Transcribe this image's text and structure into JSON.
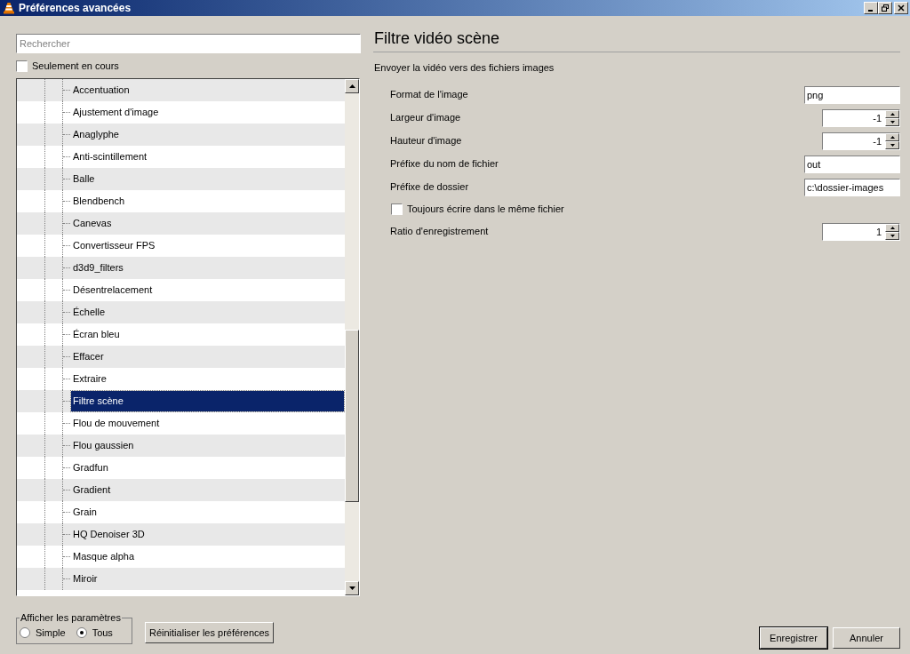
{
  "window": {
    "title": "Préférences avancées"
  },
  "search": {
    "placeholder": "Rechercher"
  },
  "only_current": {
    "label": "Seulement en cours",
    "checked": false
  },
  "tree": {
    "items": [
      {
        "label": "Accentuation",
        "selected": false
      },
      {
        "label": "Ajustement d'image",
        "selected": false
      },
      {
        "label": "Anaglyphe",
        "selected": false
      },
      {
        "label": "Anti-scintillement",
        "selected": false
      },
      {
        "label": "Balle",
        "selected": false
      },
      {
        "label": "Blendbench",
        "selected": false
      },
      {
        "label": "Canevas",
        "selected": false
      },
      {
        "label": "Convertisseur FPS",
        "selected": false
      },
      {
        "label": "d3d9_filters",
        "selected": false
      },
      {
        "label": "Désentrelacement",
        "selected": false
      },
      {
        "label": "Échelle",
        "selected": false
      },
      {
        "label": "Écran bleu",
        "selected": false
      },
      {
        "label": "Effacer",
        "selected": false
      },
      {
        "label": "Extraire",
        "selected": false
      },
      {
        "label": "Filtre scène",
        "selected": true
      },
      {
        "label": "Flou de mouvement",
        "selected": false
      },
      {
        "label": "Flou gaussien",
        "selected": false
      },
      {
        "label": "Gradfun",
        "selected": false
      },
      {
        "label": "Gradient",
        "selected": false
      },
      {
        "label": "Grain",
        "selected": false
      },
      {
        "label": "HQ Denoiser 3D",
        "selected": false
      },
      {
        "label": "Masque alpha",
        "selected": false
      },
      {
        "label": "Miroir",
        "selected": false
      }
    ]
  },
  "show_settings": {
    "legend": "Afficher les paramètres",
    "options": [
      {
        "label": "Simple",
        "selected": false
      },
      {
        "label": "Tous",
        "selected": true
      }
    ]
  },
  "reset_button": "Réinitialiser les préférences",
  "panel": {
    "title": "Filtre vidéo scène",
    "description": "Envoyer la vidéo vers des fichiers images",
    "settings": [
      {
        "kind": "text",
        "label": "Format de l'image",
        "value": "png"
      },
      {
        "kind": "spin",
        "label": "Largeur d'image",
        "value": "-1"
      },
      {
        "kind": "spin",
        "label": "Hauteur d'image",
        "value": "-1"
      },
      {
        "kind": "text",
        "label": "Préfixe du nom de fichier",
        "value": "out"
      },
      {
        "kind": "text",
        "label": "Préfixe de dossier",
        "value": "c:\\dossier-images"
      },
      {
        "kind": "checkbox",
        "label": "Toujours écrire dans le même fichier",
        "checked": false
      },
      {
        "kind": "spin",
        "label": "Ratio d'enregistrement",
        "value": "1"
      }
    ]
  },
  "buttons": [
    "Enregistrer",
    "Annuler"
  ]
}
